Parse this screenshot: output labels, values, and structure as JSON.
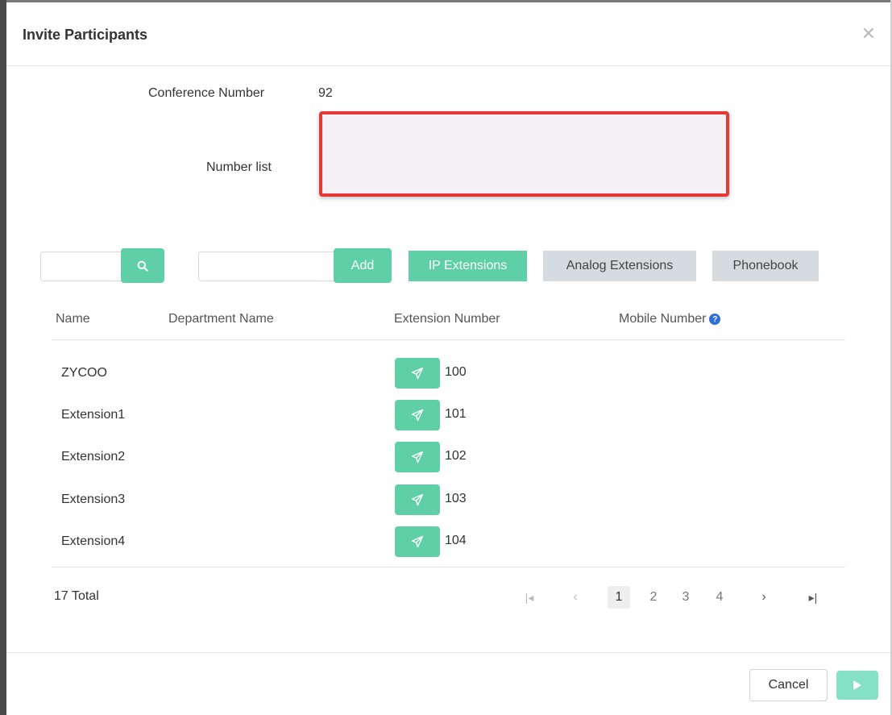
{
  "dialog": {
    "title": "Invite Participants",
    "close_icon": "close-icon"
  },
  "form": {
    "conference_label": "Conference Number",
    "conference_value": "92",
    "number_list_label": "Number list",
    "number_list_value": ""
  },
  "toolbar": {
    "search_value": "",
    "search_icon": "search-icon",
    "add_value": "",
    "add_label": "Add"
  },
  "tabs": [
    {
      "label": "IP Extensions",
      "active": true
    },
    {
      "label": "Analog Extensions",
      "active": false
    },
    {
      "label": "Phonebook",
      "active": false
    }
  ],
  "table": {
    "headers": {
      "name": "Name",
      "department": "Department Name",
      "extension": "Extension Number",
      "mobile": "Mobile Number"
    },
    "rows": [
      {
        "name": "ZYCOO",
        "department": "",
        "extension": "100",
        "mobile": ""
      },
      {
        "name": "Extension1",
        "department": "",
        "extension": "101",
        "mobile": ""
      },
      {
        "name": "Extension2",
        "department": "",
        "extension": "102",
        "mobile": ""
      },
      {
        "name": "Extension3",
        "department": "",
        "extension": "103",
        "mobile": ""
      },
      {
        "name": "Extension4",
        "department": "",
        "extension": "104",
        "mobile": ""
      }
    ]
  },
  "pagination": {
    "total_text": "17 Total",
    "pages": [
      "1",
      "2",
      "3",
      "4"
    ],
    "current": "1"
  },
  "footer": {
    "cancel_label": "Cancel"
  },
  "colors": {
    "accent": "#5ecfa6",
    "highlight_border": "#e53935",
    "tab_inactive": "#d6dbe0"
  }
}
